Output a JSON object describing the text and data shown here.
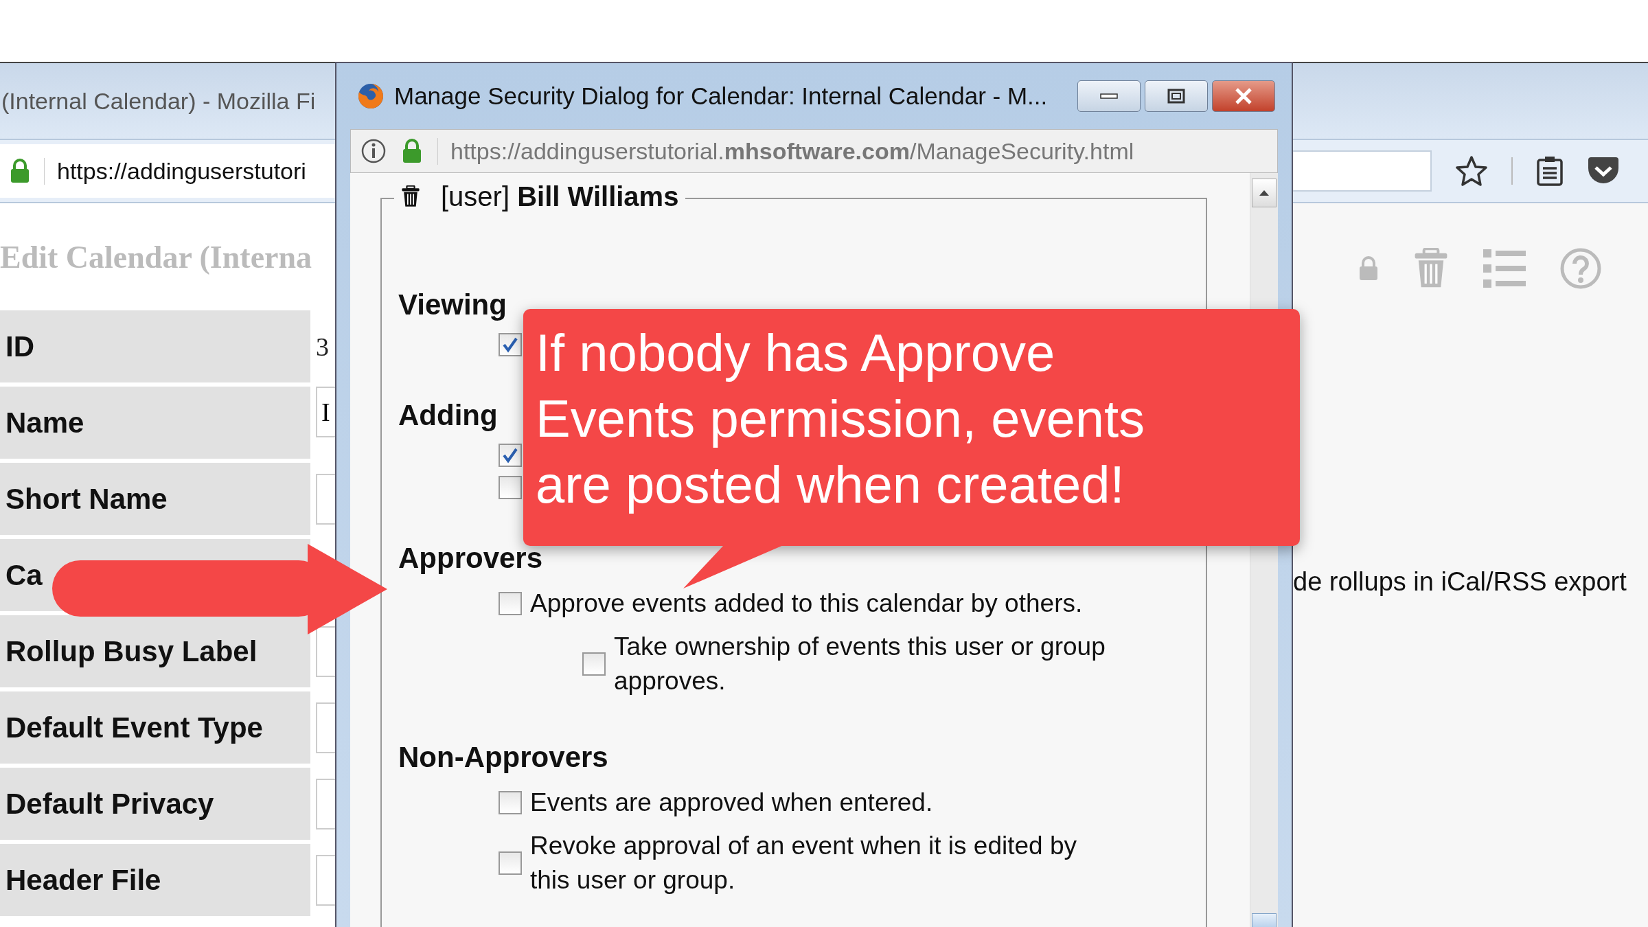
{
  "browser": {
    "title": "(Internal Calendar) - Mozilla Fi",
    "url": "https://addinguserstutori"
  },
  "page": {
    "heading": "Edit Calendar (Interna",
    "fields": [
      {
        "label": "ID",
        "value": "3"
      },
      {
        "label": "Name",
        "value": "I"
      },
      {
        "label": "Short Name",
        "input": true
      },
      {
        "label": "Ca"
      },
      {
        "label": "Rollup Busy Label",
        "input": true
      },
      {
        "label": "Default Event Type",
        "input": true
      },
      {
        "label": "Default Privacy",
        "input": true
      },
      {
        "label": "Header File",
        "input": true
      }
    ],
    "note": "de rollups in iCal/RSS export"
  },
  "dialog": {
    "title": "Manage Security Dialog for Calendar: Internal Calendar - M...",
    "url": "https://addinguserstutorial.**mhsoftware.com**/ManageSecurity.html",
    "entry": "[user] **Bill Williams**",
    "sections": [
      {
        "heading": "Viewing",
        "options": [
          {
            "checked": true
          }
        ]
      },
      {
        "heading": "Adding",
        "options": [
          {
            "checked": true
          },
          {
            "checked": false
          }
        ]
      },
      {
        "heading": "Approvers",
        "options": [
          {
            "label": "Approve events added to this calendar by others.",
            "checked": false,
            "children": [
              {
                "label": "Take ownership of events this user or group approves.",
                "checked": false
              }
            ]
          }
        ]
      },
      {
        "heading": "Non-Approvers",
        "options": [
          {
            "label": "Events are approved when entered.",
            "checked": false
          },
          {
            "label": "Revoke approval of an event when it is edited by this user or group.",
            "checked": false
          }
        ]
      }
    ]
  },
  "callout": {
    "text": "If nobody has Approve Events permission, events are posted when created!"
  }
}
